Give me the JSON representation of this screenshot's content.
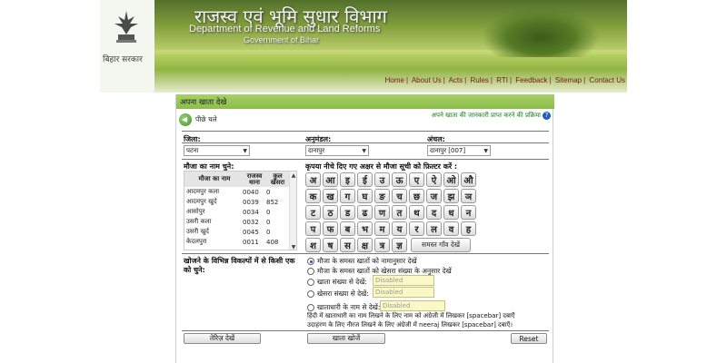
{
  "header": {
    "title_hi": "राजस्व एवं भूमि सुधार विभाग",
    "title_en": "Department of Revenue and Land Reforms",
    "subtitle": "Government of Bihar",
    "logo_text": "बिहार सरकार",
    "nav": [
      "Home",
      "About Us",
      "Acts",
      "Rules",
      "RTI",
      "Feedback",
      "Sitemap",
      "Contact Us"
    ]
  },
  "panel": {
    "title": "अपना खाता देखे",
    "back_label": "पीछे चले",
    "help_text": "अपने खाता की जानकारी प्राप्त करने की प्रक्रिया",
    "district_label": "जिला:",
    "district_value": "पटना",
    "subdivision_label": "अनुमंडल:",
    "subdivision_value": "दानापुर",
    "circle_label": "अंचल:",
    "circle_value": "दानापुर [007]",
    "mouza_label": "मौजा का नाम चुने:",
    "filter_label": "कृपया नीचे दिए गए अक्षर से मौजा सूची को फ़िल्टर करें :",
    "table_headers": [
      "मौजा का नाम",
      "राजस्व थाना",
      "कुल खेसरा"
    ],
    "rows": [
      [
        "आदमपुर कला",
        "0040",
        "0"
      ],
      [
        "आदमपुर खुर्द",
        "0039",
        "852"
      ],
      [
        "आसोपुर",
        "0034",
        "0"
      ],
      [
        "उसरी कला",
        "0032",
        "0"
      ],
      [
        "उसरी खुर्द",
        "0045",
        "0"
      ],
      [
        "केदलपुरा",
        "0011",
        "408"
      ]
    ],
    "keys": [
      [
        "अ",
        "आ",
        "इ",
        "ई",
        "उ",
        "ऊ",
        "ए",
        "ऐ",
        "ओ",
        "औ"
      ],
      [
        "क",
        "ख",
        "ग",
        "घ",
        "ङ",
        "च",
        "छ",
        "ज",
        "झ",
        "ञ"
      ],
      [
        "ट",
        "ठ",
        "ड",
        "ढ",
        "ण",
        "त",
        "थ",
        "द",
        "ध",
        "न"
      ],
      [
        "प",
        "फ",
        "ब",
        "भ",
        "म",
        "य",
        "र",
        "ल",
        "व",
        "ह"
      ],
      [
        "श",
        "ष",
        "स",
        "क्ष",
        "त्र",
        "ज्ञ"
      ]
    ],
    "all_villages_label": "समस्त गाँव देखें",
    "search_options_label": "खोजने के विभिन्न विकल्पों में से किसी एक को चुने:",
    "options": [
      "मौजा के समस्त खातों को नामानुसार देखें",
      "मौजा के समस्त खातों को खेसरा संख्या के अनुसार देखें",
      "खाता संख्या से देखें:",
      "खेसरा संख्या से देखें:",
      "खाताधारी के नाम से देखें:"
    ],
    "disabled_placeholder": "Disabled",
    "note1": "हिंदी में खाताधारी का नाम लिखने के लिए नाम को अंग्रेजी में लिखकर [spacebar] दबाएँ",
    "note2": "उदाहरण के लिए नीरज लिखने के लिए अंग्रेजी में neeraj लिखकर [spacebar] दबाएँ।",
    "btn_register": "तेरिज़ देखें",
    "btn_search": "खाता खोजें",
    "btn_reset": "Reset"
  }
}
